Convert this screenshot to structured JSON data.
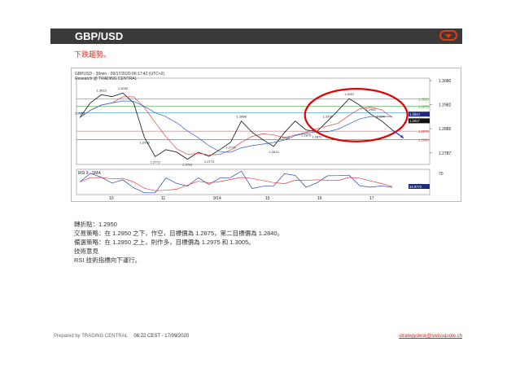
{
  "header": {
    "title": "GBP/USD",
    "menu_icon": "chevron-down-icon",
    "accent": "#e23a12"
  },
  "subtitle": "下跌趨勢。",
  "chart": {
    "header_line1": "GBPUSD - 30min - 09/17/2020 06:17:42 (UTC+2)",
    "header_line2": "Research @ TRADING CENTRAL",
    "rsi_label": "RSI 9 - SMA",
    "rsi_level": "70",
    "y_ticks": [
      "1.3080",
      "1.2982",
      "1.2885",
      "1.2787"
    ],
    "x_ticks": [
      "10",
      "11",
      "9/14",
      "15",
      "16",
      "17"
    ],
    "level_labels": [
      "1.3005",
      "1.2975",
      "1.2950",
      "1.2944",
      "1.2917",
      "1.2875",
      "1.2840"
    ],
    "price_annotations": [
      "1.3023",
      "1.3030",
      "1.2916",
      "1.2863",
      "1.2888",
      "1.2916",
      "1.2916",
      "1.3007",
      "1.2772",
      "1.2761",
      "1.2773",
      "1.2773",
      "1.2813",
      "1.2873",
      "1.2875",
      "1.2950",
      "1.294"
    ],
    "rsi_value": "34.9772",
    "colors": {
      "resistance": "#2e9a2e",
      "support": "#e03030",
      "price": "#111111",
      "ma_fast": "#e04040",
      "ma_slow": "#3060d0",
      "circle": "#e00000",
      "arrow": "#2040c0"
    }
  },
  "chart_data": {
    "type": "line",
    "title": "GBPUSD - 30min - 09/17/2020 06:17:42 (UTC+2)",
    "x": [
      "10",
      "11",
      "9/14",
      "15",
      "16",
      "17"
    ],
    "ylim": [
      1.274,
      1.309
    ],
    "y_ticks": [
      1.308,
      1.2982,
      1.2885,
      1.2787
    ],
    "series": [
      {
        "name": "GBPUSD",
        "values": [
          1.293,
          1.299,
          1.3023,
          1.3015,
          1.303,
          1.299,
          1.285,
          1.2772,
          1.28,
          1.279,
          1.2761,
          1.279,
          1.2773,
          1.28,
          1.283,
          1.2916,
          1.287,
          1.284,
          1.2813,
          1.287,
          1.2916,
          1.288,
          1.2873,
          1.2916,
          1.296,
          1.3007,
          1.298,
          1.2944,
          1.2917,
          1.288
        ]
      }
    ],
    "levels": {
      "resistance": [
        1.3005,
        1.2975
      ],
      "pivot": 1.295,
      "support": [
        1.2875,
        1.284
      ]
    }
  },
  "text": {
    "pivot": "轉折點：1.2950",
    "trade": "交易策略：在 1.2950 之下，作空，目標價為 1.2875，第二目標價為 1.2840。",
    "alt": "備選策略：在 1.2950 之上，則作多，目標價為 1.2975 和 1.3005。",
    "comment_title": "技術意見",
    "comment": "RSI 技術指標向下運行。"
  },
  "footer": {
    "prepared": "Prepared by TRADING CENTRAL",
    "time": "06:22 CEST - 17/09/2020",
    "email": "strategydesk@swissquote.ch"
  }
}
